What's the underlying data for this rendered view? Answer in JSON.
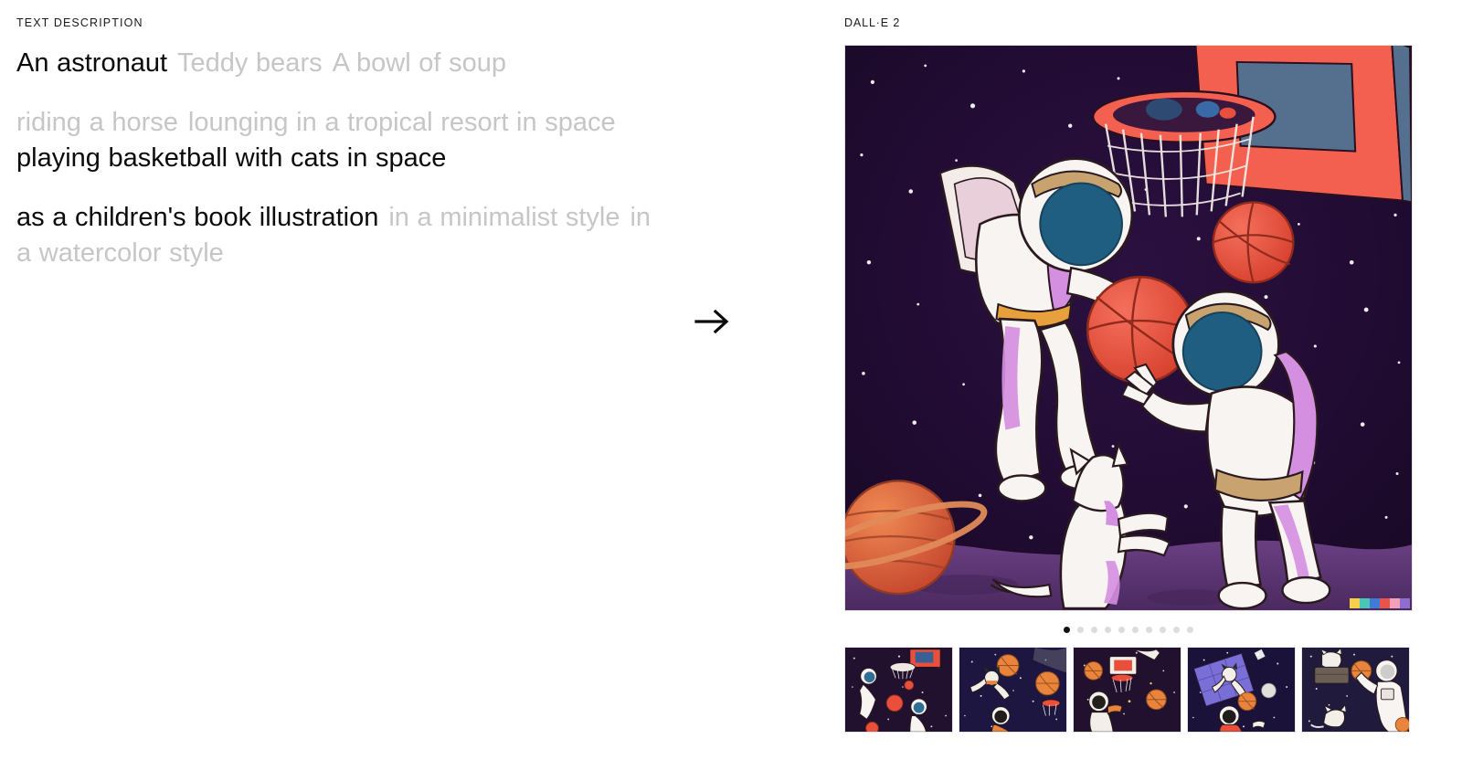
{
  "left": {
    "section_label": "TEXT DESCRIPTION",
    "rows": [
      {
        "id": "subject",
        "chips": [
          {
            "label": "An astronaut",
            "selected": true
          },
          {
            "label": "Teddy bears",
            "selected": false
          },
          {
            "label": "A bowl of soup",
            "selected": false
          }
        ]
      },
      {
        "id": "action",
        "chips": [
          {
            "label": "riding a horse",
            "selected": false
          },
          {
            "label": "lounging in a tropical resort in space",
            "selected": false
          },
          {
            "label": "playing basketball with cats in space",
            "selected": true
          }
        ]
      },
      {
        "id": "style",
        "chips": [
          {
            "label": "as a children's book illustration",
            "selected": true
          },
          {
            "label": "in a minimalist style",
            "selected": false
          },
          {
            "label": "in a watercolor style",
            "selected": false
          }
        ]
      }
    ]
  },
  "arrow": {
    "icon": "arrow-right-icon"
  },
  "right": {
    "label": "DALL·E 2",
    "hero": {
      "alt": "An astronaut playing basketball with cats in space as a children's book illustration",
      "watermark_colors": [
        "#f5d14b",
        "#49c6b6",
        "#3f7ad6",
        "#e8534a",
        "#f0a0b8",
        "#8e6fd0"
      ]
    },
    "pagination": {
      "count": 10,
      "active_index": 0
    },
    "thumbnails": [
      {
        "id": "thumb-1",
        "alt": "two astronauts and basketball hoop with planets"
      },
      {
        "id": "thumb-2",
        "alt": "cat in spacesuit floating with basketballs and hoop"
      },
      {
        "id": "thumb-3",
        "alt": "astronaut reaching toward white hoop with basketballs"
      },
      {
        "id": "thumb-4",
        "alt": "cat on solar panel satellite with astronaut and planet"
      },
      {
        "id": "thumb-5",
        "alt": "astronaut holding basketball with cats on rock"
      }
    ]
  },
  "palette": {
    "text_selected": "#0b0b0b",
    "text_muted": "#c6c6c6",
    "background": "#ffffff",
    "space_dark": "#1b0d2b",
    "space_deep": "#2a0f3d",
    "ball_red": "#e8503c",
    "hoop_coral": "#f4604f",
    "board_slate": "#55708f",
    "visor_blue": "#1f5e80",
    "suit_white": "#f7f4f2",
    "suit_accent": "#d48fe0",
    "ground_purple": "#5b3570",
    "planet_orange": "#e06a3a"
  }
}
